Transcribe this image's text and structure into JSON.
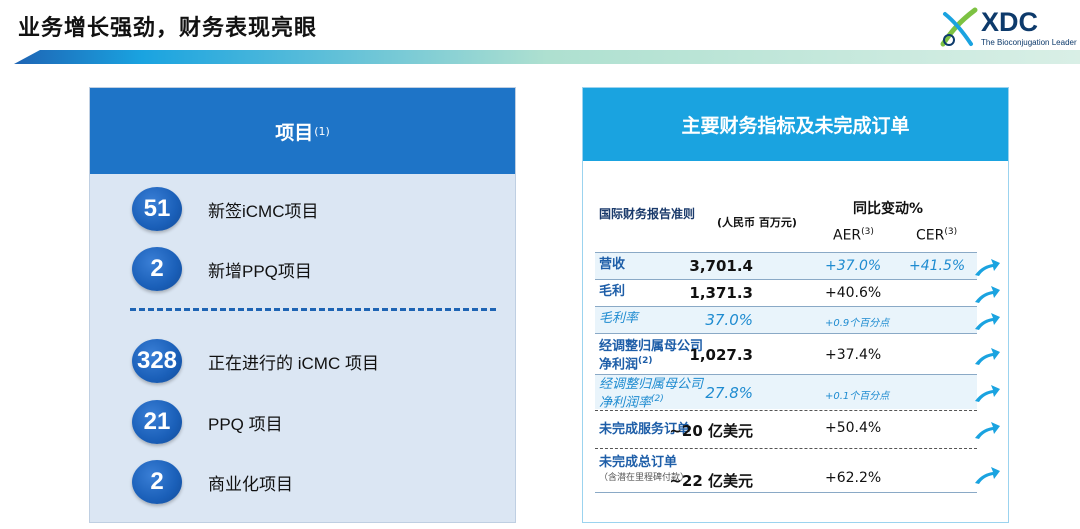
{
  "page_title": "业务增长强劲，财务表现亮眼",
  "logo": {
    "text": "XDC",
    "tagline": "The Bioconjugation Leader"
  },
  "projects_card": {
    "title": "项目",
    "title_note": "(1)",
    "items": [
      {
        "value": "51",
        "label": "新签iCMC项目"
      },
      {
        "value": "2",
        "label": "新增PPQ项目"
      },
      {
        "value": "328",
        "label": "正在进行的 iCMC 项目"
      },
      {
        "value": "21",
        "label": "PPQ 项目"
      },
      {
        "value": "2",
        "label": "商业化项目"
      }
    ]
  },
  "finance_card": {
    "title": "主要财务指标及未完成订单",
    "header": {
      "standard": "国际财务报告准则",
      "unit": "(人民币 百万元)",
      "yoy": "同比变动%",
      "aer": "AER",
      "aer_note": "(3)",
      "cer": "CER",
      "cer_note": "(3)"
    },
    "rows": [
      {
        "label": "营收",
        "value": "3,701.4",
        "aer": "+37.0%",
        "cer": "+41.5%"
      },
      {
        "label": "毛利",
        "value": "1,371.3",
        "aer": "+40.6%",
        "cer": ""
      },
      {
        "label": "毛利率",
        "value": "37.0%",
        "aer": "+0.9个百分点",
        "cer": ""
      },
      {
        "label": "经调整归属母公司净利润",
        "label_note": "(2)",
        "value": "1,027.3",
        "aer": "+37.4%",
        "cer": ""
      },
      {
        "label": "经调整归属母公司净利润率",
        "label_note": "(2)",
        "value": "27.8%",
        "aer": "+0.1个百分点",
        "cer": ""
      },
      {
        "label": "未完成服务订单",
        "value": "~20 亿美元",
        "aer": "+50.4%",
        "cer": ""
      },
      {
        "label": "未完成总订单",
        "sublabel": "（含潜在里程碑付款）",
        "value": "~22 亿美元",
        "aer": "+62.2%",
        "cer": ""
      }
    ]
  },
  "colors": {
    "left_header": "#1e74c7",
    "left_body": "#dbe6f3",
    "right_header": "#1aa3e0",
    "circle": "#1a5fb8",
    "arrow": "#1aa3e0"
  }
}
